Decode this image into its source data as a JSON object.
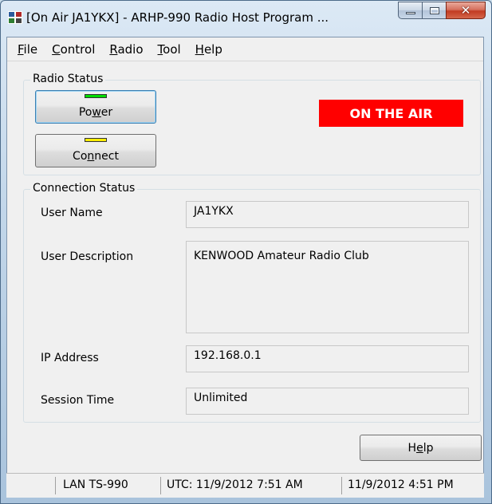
{
  "window": {
    "title": "[On Air JA1YKX] - ARHP-990 Radio Host Program ...",
    "close_glyph": "✕"
  },
  "menu": {
    "items": [
      {
        "label_u": "F",
        "label_rest": "ile"
      },
      {
        "label_u": "C",
        "label_rest": "ontrol"
      },
      {
        "label_u": "R",
        "label_rest": "adio"
      },
      {
        "label_u": "T",
        "label_rest": "ool"
      },
      {
        "label_u": "H",
        "label_rest": "elp"
      }
    ]
  },
  "radio_status": {
    "title": "Radio Status",
    "power": {
      "pre": "Po",
      "u": "w",
      "post": "er",
      "led_color": "#00dd00"
    },
    "connect": {
      "pre": "Co",
      "u": "n",
      "post": "nect",
      "led_color": "#ffee00"
    },
    "on_air": "ON THE AIR"
  },
  "connection_status": {
    "title": "Connection Status",
    "user_name_label": "User Name",
    "user_name": "JA1YKX",
    "user_description_label": "User Description",
    "user_description": "KENWOOD Amateur Radio Club",
    "ip_address_label": "IP Address",
    "ip_address": "192.168.0.1",
    "session_time_label": "Session Time",
    "session_time": "Unlimited"
  },
  "help_button": {
    "pre": "H",
    "u": "e",
    "post": "lp"
  },
  "statusbar": {
    "connection": "LAN TS-990",
    "utc": "UTC: 11/9/2012 7:51 AM",
    "local": "11/9/2012 4:51 PM"
  },
  "colors": {
    "on_air_bg": "#ff0000",
    "on_air_text": "#ffffff"
  }
}
